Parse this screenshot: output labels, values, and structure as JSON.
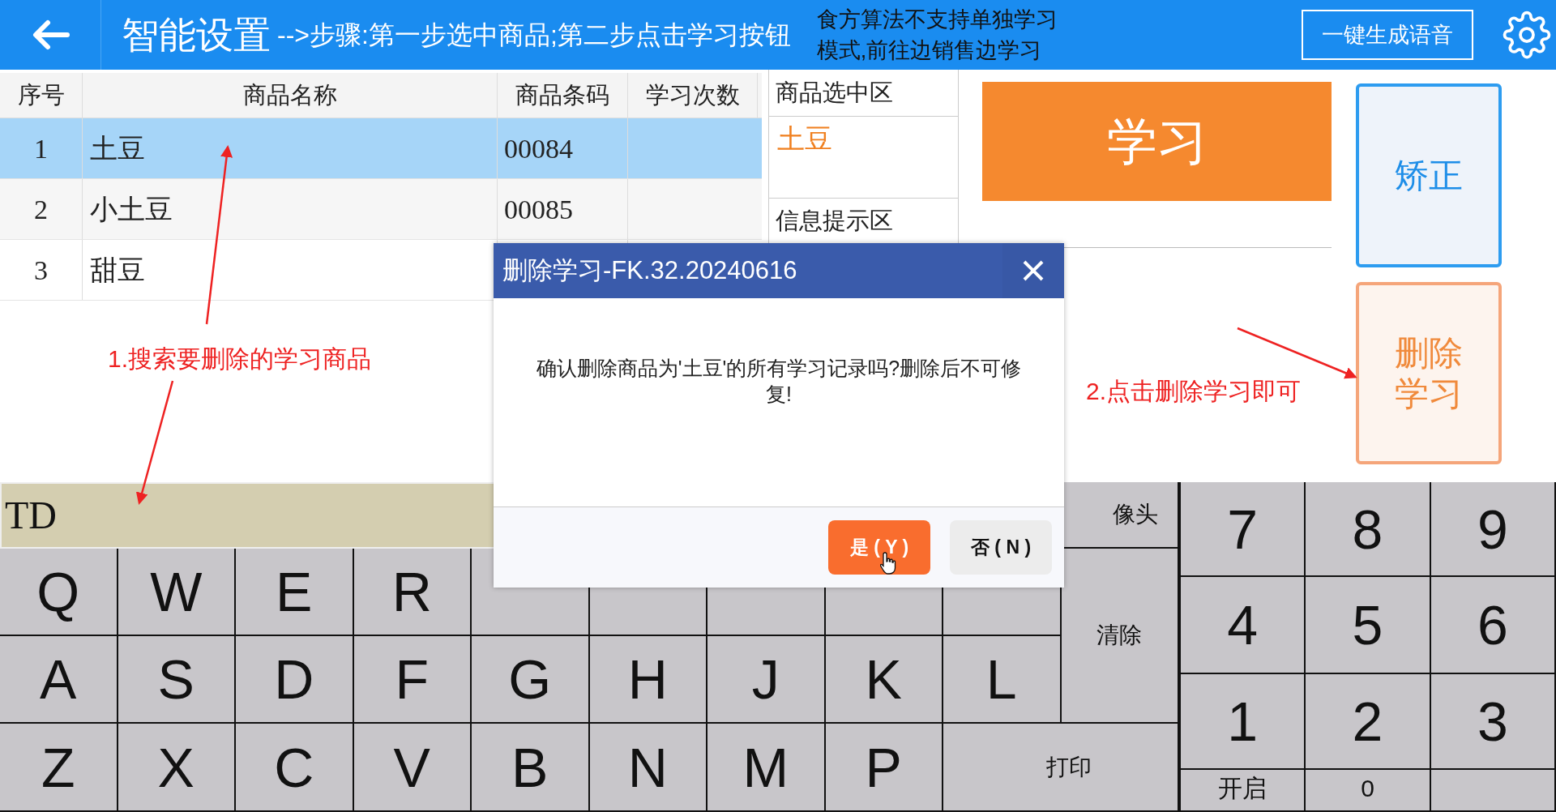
{
  "header": {
    "title": "智能设置",
    "steps": "-->步骤:第一步选中商品;第二步点击学习按钮",
    "notice_lines": [
      "食方算法不支持单独学习",
      "模式,前往边销售边学习"
    ],
    "voice_button": "一键生成语音"
  },
  "table": {
    "columns": [
      "序号",
      "商品名称",
      "商品条码",
      "学习次数"
    ],
    "rows": [
      {
        "no": "1",
        "name": "土豆",
        "barcode": "00084",
        "selected": true
      },
      {
        "no": "2",
        "name": "小土豆",
        "barcode": "00085",
        "selected": false
      },
      {
        "no": "3",
        "name": "甜豆",
        "selected": false
      }
    ]
  },
  "selection_panel": {
    "title": "商品选中区",
    "value": "土豆"
  },
  "info_panel": {
    "title": "信息提示区"
  },
  "learn_button": "学习",
  "correct_button": "矫正",
  "delete_button": "删除学习",
  "annotations": [
    "1.搜索要删除的学习商品",
    "2.点击删除学习即可"
  ],
  "search_field": {
    "value": "TD"
  },
  "keyboard": {
    "letter_rows": [
      [
        "Q",
        "W",
        "E",
        "R"
      ],
      [
        "A",
        "S",
        "D",
        "F",
        "G",
        "H",
        "J",
        "K",
        "L"
      ],
      [
        "Z",
        "X",
        "C",
        "V",
        "B",
        "N",
        "M",
        "P"
      ]
    ],
    "camera_key": "像头",
    "clear_key": "清除",
    "print_key": "打印",
    "numpad": [
      "7",
      "8",
      "9",
      "4",
      "5",
      "6",
      "1",
      "2",
      "3",
      "开启",
      "0"
    ]
  },
  "dialog": {
    "title": "删除学习-FK.32.20240616",
    "message": "确认删除商品为'土豆'的所有学习记录吗?删除后不可修复!",
    "buttons": [
      {
        "label": "是 ( Y )",
        "kind": "primary"
      },
      {
        "label": "否 ( N )",
        "kind": "secondary"
      }
    ]
  }
}
